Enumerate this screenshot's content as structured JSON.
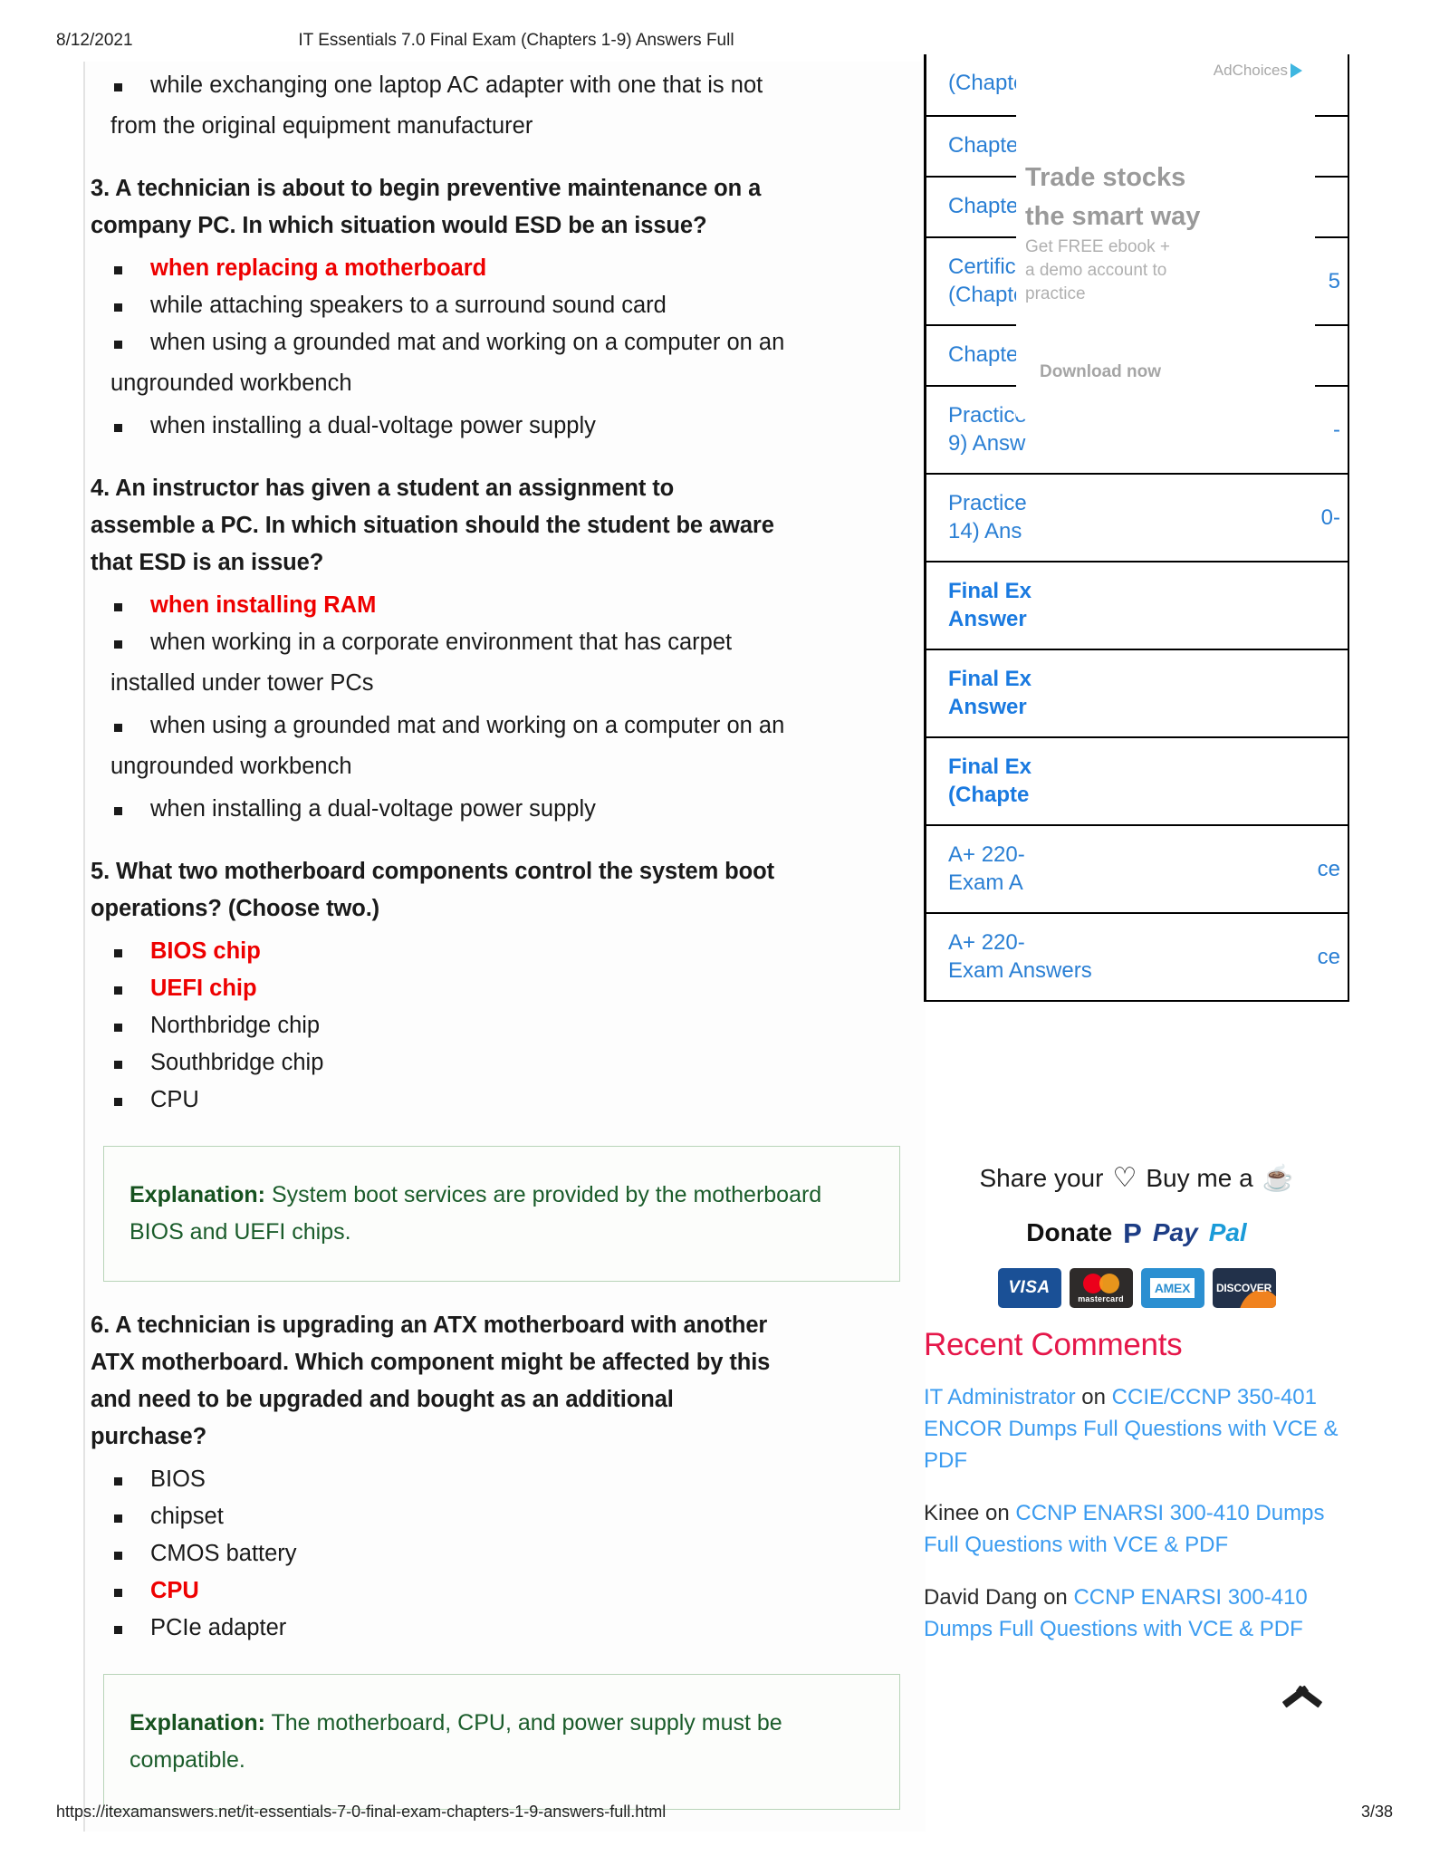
{
  "print_header": {
    "date": "8/12/2021",
    "title": "IT Essentials 7.0 Final Exam (Chapters 1-9) Answers Full"
  },
  "print_footer": {
    "url": "https://itexamanswers.net/it-essentials-7-0-final-exam-chapters-1-9-answers-full.html",
    "page": "3/38"
  },
  "article": {
    "carryover_bullet": "while exchanging one laptop AC adapter with one that is not",
    "carryover_wrap": "from the original equipment manufacturer",
    "questions": [
      {
        "heading_line1": "3. A technician is about to begin preventive maintenance on a",
        "heading_line2": "company PC. In which situation would ESD be an issue?",
        "answers": [
          {
            "text": "when replacing a motherboard",
            "correct": true
          },
          {
            "text": "while attaching speakers to a surround sound card",
            "correct": false
          },
          {
            "text": "when using a grounded mat and working on a computer on an",
            "correct": false
          },
          {
            "text": "ungrounded workbench",
            "correct": false,
            "wrap": true
          },
          {
            "text": "when installing a dual-voltage power supply",
            "correct": false
          }
        ]
      },
      {
        "heading_line1": "4. An instructor has given a student an assignment to",
        "heading_line2": "assemble a PC. In which situation should the student be aware",
        "heading_line3": "that ESD is an issue?",
        "answers": [
          {
            "text": "when installing RAM",
            "correct": true
          },
          {
            "text": "when working in a corporate environment that has carpet",
            "correct": false
          },
          {
            "text": "installed under tower PCs",
            "correct": false,
            "wrap": true
          },
          {
            "text": "when using a grounded mat and working on a computer on an",
            "correct": false
          },
          {
            "text": "ungrounded workbench",
            "correct": false,
            "wrap": true
          },
          {
            "text": "when installing a dual-voltage power supply",
            "correct": false
          }
        ]
      },
      {
        "heading_line1": "5. What two motherboard components control the system boot",
        "heading_line2": "operations? (Choose two.)",
        "answers": [
          {
            "text": "BIOS chip",
            "correct": true
          },
          {
            "text": "UEFI chip",
            "correct": true
          },
          {
            "text": "Northbridge chip",
            "correct": false
          },
          {
            "text": "Southbridge chip",
            "correct": false
          },
          {
            "text": "CPU",
            "correct": false
          }
        ],
        "explanation_label": "Explanation:",
        "explanation_text": " System boot services are provided by the motherboard BIOS and UEFI chips."
      },
      {
        "heading_line1": "6. A technician is upgrading an ATX motherboard with another",
        "heading_line2": "ATX motherboard. Which component might be affected by this",
        "heading_line3": "and need to be upgraded and bought as an additional",
        "heading_line4": "purchase?",
        "answers": [
          {
            "text": "BIOS",
            "correct": false
          },
          {
            "text": "chipset",
            "correct": false
          },
          {
            "text": "CMOS battery",
            "correct": false
          },
          {
            "text": "CPU",
            "correct": true
          },
          {
            "text": "PCIe adapter",
            "correct": false
          }
        ],
        "explanation_label": "Explanation:",
        "explanation_text": " The motherboard, CPU, and power supply must be compatible."
      }
    ]
  },
  "sidebar": {
    "related_rows": [
      {
        "text": "(Chapte",
        "tail": "",
        "bold": false
      },
      {
        "text": "Chapter",
        "tail": "",
        "bold": false
      },
      {
        "text": "Chapter",
        "tail": "",
        "bold": false
      },
      {
        "text": "Certifica",
        "text2": "(Chapte",
        "tail": "5",
        "bold": false
      },
      {
        "text": "Chapter",
        "tail": "",
        "bold": false
      },
      {
        "text": "Practice",
        "text2": "9) Answ",
        "tail": "-",
        "bold": false
      },
      {
        "text": "Practice",
        "text2": "14) Ans\u0001",
        "tail": "0-",
        "bold": false
      },
      {
        "text": "Final Ex",
        "text2": "Answer",
        "tail": "",
        "bold": true
      },
      {
        "text": "Final Ex",
        "text2": "Answer",
        "tail": "",
        "bold": true
      },
      {
        "text": "Final Ex",
        "text2": "(Chapte",
        "tail": "",
        "bold": true
      },
      {
        "text": "A+ 220-",
        "text2": "Exam A",
        "tail": "ce",
        "bold": false
      },
      {
        "text": "A+ 220-",
        "text2": "Exam Answers",
        "tail": "ce",
        "bold": false
      }
    ],
    "ad": {
      "adchoices_label": "AdChoices",
      "headline_line1": "Trade stocks",
      "headline_line2": "the smart way",
      "sub_line1": "Get FREE ebook +",
      "sub_line2": "a demo account to",
      "sub_line3": "practice",
      "cta": "Download now"
    },
    "share": {
      "share_text": "Share your",
      "heart_icon": "heart-icon",
      "buy_text": "Buy me a",
      "coffee_icon": "coffee-cup-icon"
    },
    "donate": {
      "label": "Donate",
      "paypal_mark": "P",
      "paypal_pay": "Pay",
      "paypal_pal": "Pal"
    },
    "cards": [
      {
        "name": "VISA"
      },
      {
        "name": "mastercard"
      },
      {
        "name": "AMEX"
      },
      {
        "name": "DISCOVER"
      }
    ],
    "recent_comments_title": "Recent Comments",
    "comments": [
      {
        "author": "IT Administrator",
        "author_is_link": true,
        "on": " on ",
        "post": "CCIE/CCNP 350-401 ENCOR Dumps Full Questions with VCE & PDF"
      },
      {
        "author": "Kinee",
        "author_is_link": false,
        "on": " on ",
        "post": "CCNP ENARSI 300-410 Dumps Full Questions with VCE & PDF"
      },
      {
        "author": "David Dang",
        "author_is_link": false,
        "on": " on ",
        "post": "CCNP ENARSI 300-410 Dumps Full Questions with VCE & PDF"
      }
    ],
    "scroll_top_icon": "chevron-up-icon"
  },
  "colors": {
    "correct_answer": "#ee0000",
    "link_blue": "#2a7fd4",
    "comment_link_blue": "#3a9bf0",
    "explanation_green": "#1a5c2a",
    "recent_comments_pink": "#e5174a"
  }
}
